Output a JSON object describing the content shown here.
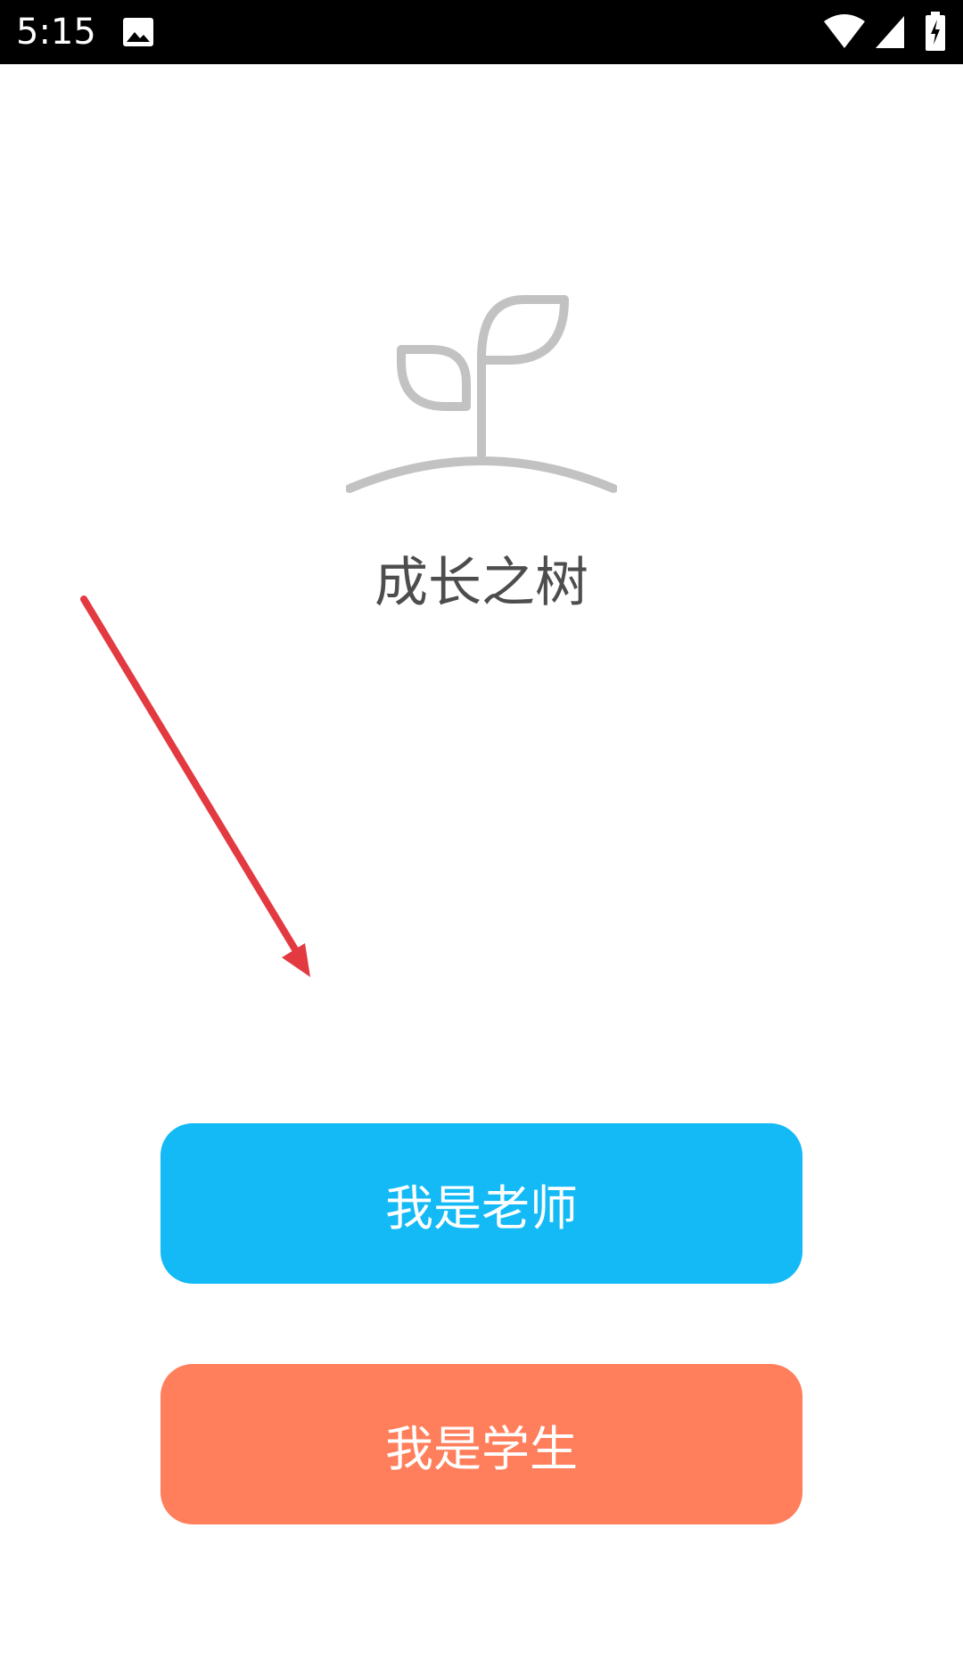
{
  "status_bar": {
    "time": "5:15",
    "icons": [
      "image-icon",
      "wifi-icon",
      "cellular-signal-icon",
      "battery-charging-icon"
    ]
  },
  "app": {
    "logo_icon": "sprout-icon",
    "name": "成长之树"
  },
  "annotation": {
    "arrow_icon": "red-arrow-annotation-icon",
    "color": "#e23a40"
  },
  "buttons": {
    "teacher_label": "我是老师",
    "student_label": "我是学生"
  },
  "colors": {
    "teacher_button": "#14baf5",
    "student_button": "#ff7f5c",
    "logo": "#c2c2c2",
    "app_name_text": "#4d4d4d",
    "status_bar_bg": "#000000"
  }
}
